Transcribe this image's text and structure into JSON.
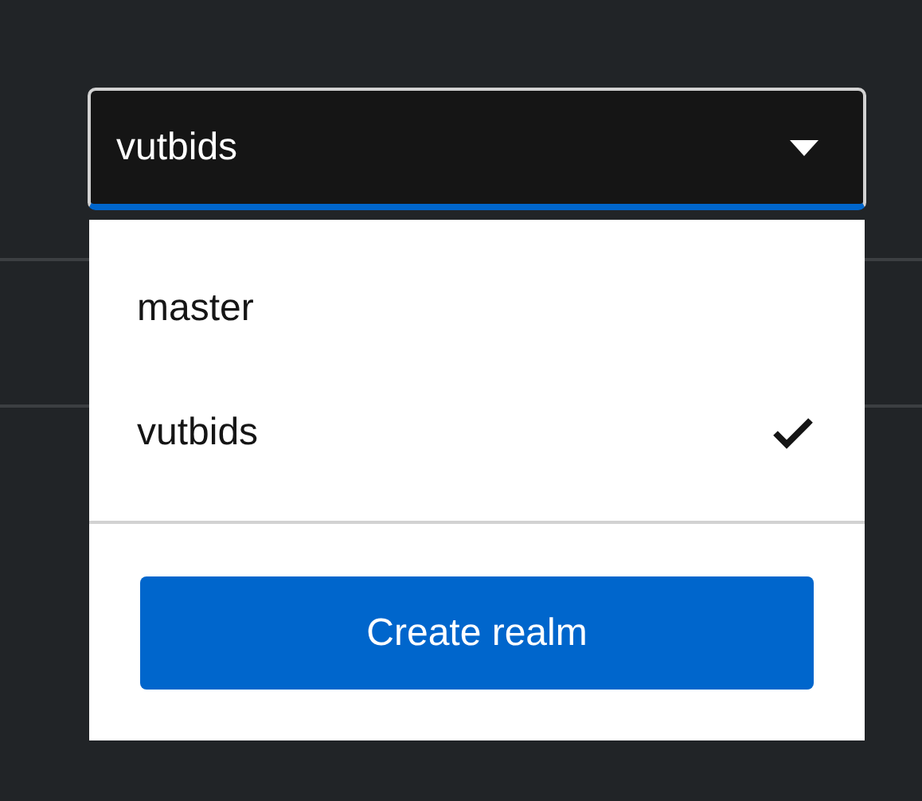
{
  "realm_selector": {
    "value": "vutbids",
    "expanded": true
  },
  "realms": [
    {
      "name": "master",
      "selected": false
    },
    {
      "name": "vutbids",
      "selected": true
    }
  ],
  "create_button": "Create realm"
}
